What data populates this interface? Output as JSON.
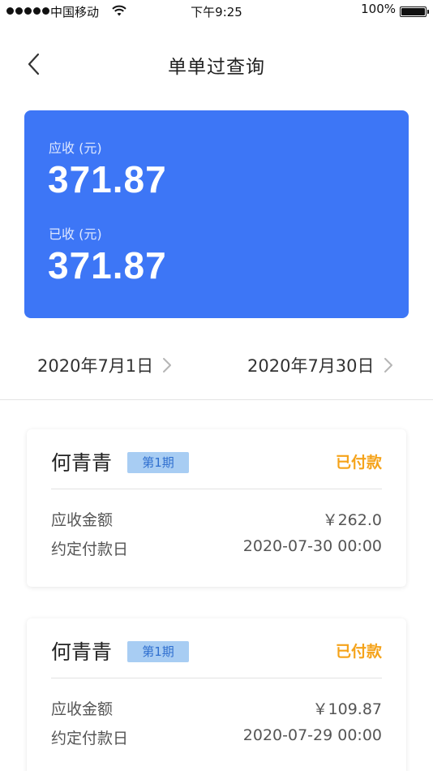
{
  "status_bar": {
    "carrier": "中国移动",
    "time": "下午9:25",
    "battery": "100%"
  },
  "nav": {
    "title": "单单过查询"
  },
  "summary": {
    "receivable_label": "应收 (元)",
    "receivable_amount": "371.87",
    "received_label": "已收 (元)",
    "received_amount": "371.87",
    "background": "#3d76f6"
  },
  "date_range": {
    "start": "2020年7月1日",
    "end": "2020年7月30日"
  },
  "records": [
    {
      "name": "何青青",
      "period": "第1期",
      "status": "已付款",
      "amount_label": "应收金额",
      "amount": "￥262.0",
      "due_label": "约定付款日",
      "due_date": "2020-07-30 00:00"
    },
    {
      "name": "何青青",
      "period": "第1期",
      "status": "已付款",
      "amount_label": "应收金额",
      "amount": "￥109.87",
      "due_label": "约定付款日",
      "due_date": "2020-07-29 00:00"
    }
  ],
  "colors": {
    "accent": "#3d76f6",
    "paid": "#f5a31a",
    "period_badge": "#a8cdf3"
  }
}
